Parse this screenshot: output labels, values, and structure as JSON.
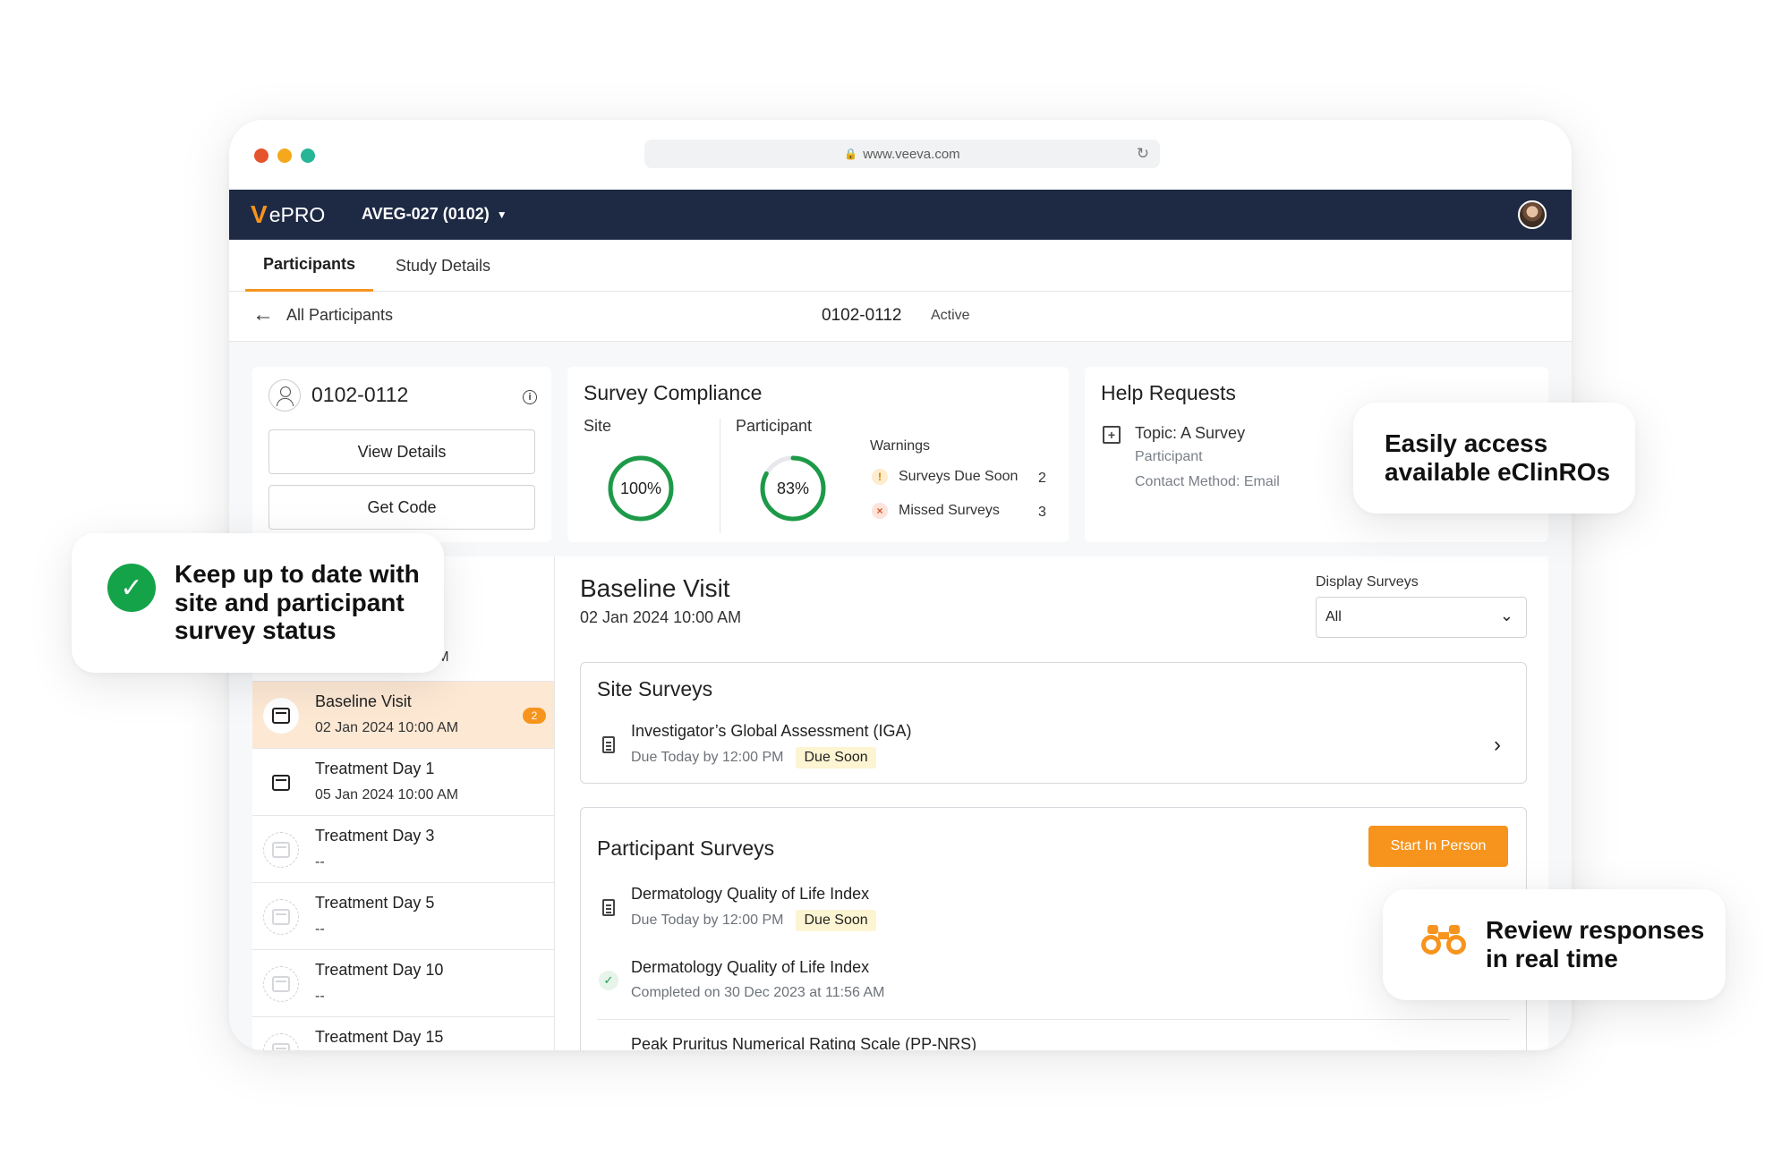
{
  "browser": {
    "url": "www.veeva.com",
    "dot_colors": [
      "#e5542c",
      "#f5a81c",
      "#27b597"
    ]
  },
  "header": {
    "logo_v": "V",
    "logo_text": "ePRO",
    "study": "AVEG-027 (0102)"
  },
  "tabs": [
    {
      "label": "Participants",
      "active": true
    },
    {
      "label": "Study Details",
      "active": false
    }
  ],
  "participant_bar": {
    "back_label": "All Participants",
    "participant_id": "0102-0112",
    "status": "Active"
  },
  "participant_card": {
    "id": "0102-0112",
    "view_details_label": "View Details",
    "get_code_label": "Get Code"
  },
  "compliance": {
    "title": "Survey Compliance",
    "site_label": "Site",
    "site_value": "100%",
    "site_percent": 100,
    "participant_label": "Participant",
    "participant_value": "83%",
    "participant_percent": 83,
    "warnings_title": "Warnings",
    "warnings": [
      {
        "label": "Surveys Due Soon",
        "count": "2",
        "icon": "!"
      },
      {
        "label": "Missed Surveys",
        "count": "3",
        "icon": "×"
      }
    ]
  },
  "help": {
    "title": "Help Requests",
    "topic": "Topic: A Survey",
    "role": "Participant",
    "contact": "Contact Method: Email"
  },
  "visits": {
    "hidden_partial_date_tail": "J AM",
    "items": [
      {
        "name": "Baseline Visit",
        "date": "02 Jan 2024 10:00 AM",
        "badge": "2",
        "selected": true
      },
      {
        "name": "Treatment Day 1",
        "date": "05 Jan 2024 10:00 AM"
      },
      {
        "name": "Treatment Day 3",
        "date": "--"
      },
      {
        "name": "Treatment Day 5",
        "date": "--"
      },
      {
        "name": "Treatment Day 10",
        "date": "--"
      },
      {
        "name": "Treatment Day 15",
        "date": ""
      }
    ]
  },
  "detail": {
    "title": "Baseline Visit",
    "date": "02 Jan 2024 10:00 AM",
    "display_label": "Display Surveys",
    "display_value": "All",
    "site_surveys_title": "Site Surveys",
    "site_surveys": [
      {
        "name": "Investigator’s Global Assessment (IGA)",
        "due": "Due Today by 12:00 PM",
        "tag": "Due Soon"
      }
    ],
    "participant_surveys_title": "Participant Surveys",
    "start_in_person_label": "Start In Person",
    "participant_surveys": [
      {
        "name": "Dermatology Quality of Life Index",
        "due": "Due Today by 12:00 PM",
        "tag": "Due Soon"
      },
      {
        "name": "Dermatology Quality of Life Index",
        "due": "Completed on 30 Dec 2023 at 11:56 AM"
      },
      {
        "name": "Peak Pruritus Numerical Rating Scale (PP-NRS)"
      }
    ]
  },
  "callouts": {
    "status": "Keep up to date with site and participant survey status",
    "eclinros": "Easily access available eClinROs",
    "realtime": "Review responses in real time"
  },
  "colors": {
    "accent": "#f7941d",
    "navy": "#1e2a44",
    "ring_green": "#1d9a48",
    "callout_green": "#15a34a"
  }
}
